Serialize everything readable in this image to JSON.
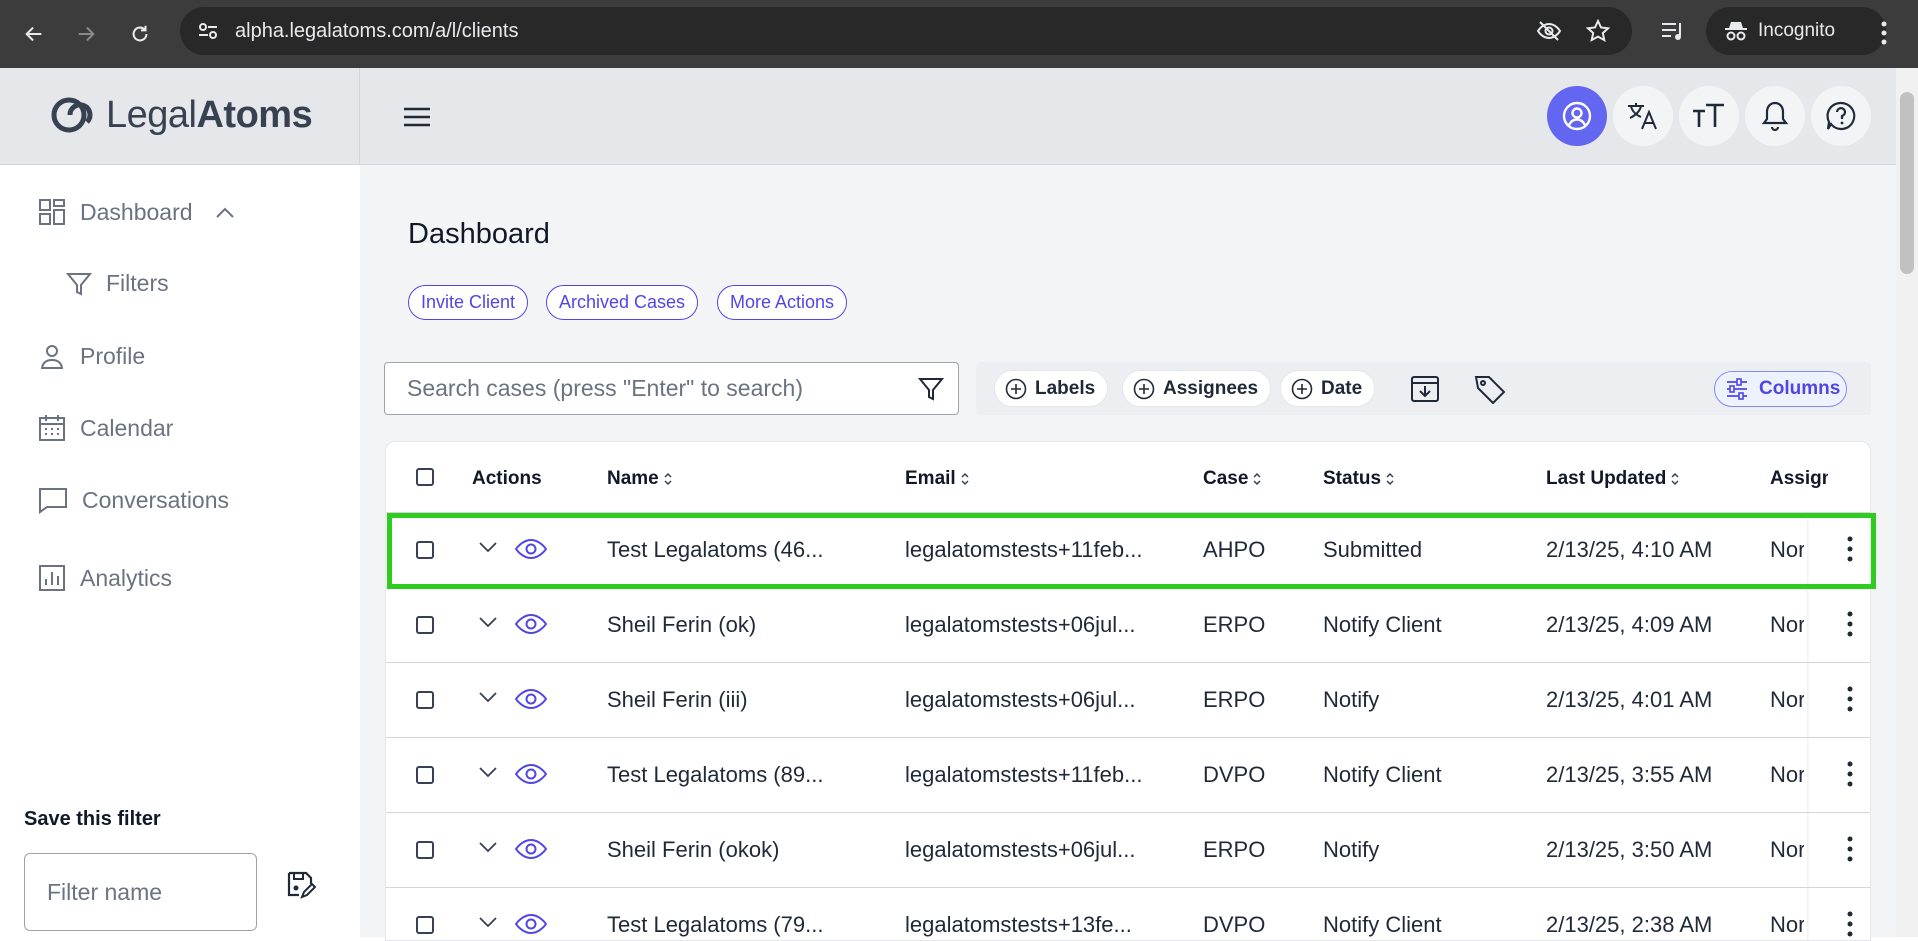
{
  "browser": {
    "url": "alpha.legalatoms.com/a/l/clients",
    "profile_label": "Incognito"
  },
  "brand": {
    "name_light": "Legal",
    "name_bold": "Atoms",
    "accent": "#6366f1"
  },
  "sidebar": {
    "items": [
      {
        "label": "Dashboard",
        "icon": "grid-icon"
      },
      {
        "label": "Filters",
        "icon": "filter-icon"
      },
      {
        "label": "Profile",
        "icon": "user-icon"
      },
      {
        "label": "Calendar",
        "icon": "calendar-icon"
      },
      {
        "label": "Conversations",
        "icon": "chat-icon"
      },
      {
        "label": "Analytics",
        "icon": "bar-chart-icon"
      }
    ],
    "save_filter_title": "Save this filter",
    "filter_name_placeholder": "Filter name"
  },
  "main": {
    "title": "Dashboard",
    "pills": [
      "Invite Client",
      "Archived Cases",
      "More Actions"
    ],
    "search_placeholder": "Search cases (press \"Enter\" to search)",
    "chips": [
      "Labels",
      "Assignees",
      "Date"
    ],
    "columns_label": "Columns"
  },
  "table": {
    "headers": {
      "actions": "Actions",
      "name": "Name",
      "email": "Email",
      "case": "Case",
      "status": "Status",
      "last_updated": "Last Updated",
      "assignee": "Assign"
    },
    "rows": [
      {
        "name": "Test Legalatoms (46...",
        "email": "legalatomstests+11feb...",
        "case": "AHPO",
        "status": "Submitted",
        "updated": "2/13/25, 4:10 AM",
        "assignee": "Nor"
      },
      {
        "name": "Sheil Ferin (ok)",
        "email": "legalatomstests+06jul...",
        "case": "ERPO",
        "status": "Notify Client",
        "updated": "2/13/25, 4:09 AM",
        "assignee": "Nor"
      },
      {
        "name": "Sheil Ferin (iii)",
        "email": "legalatomstests+06jul...",
        "case": "ERPO",
        "status": "Notify",
        "updated": "2/13/25, 4:01 AM",
        "assignee": "Nor"
      },
      {
        "name": "Test Legalatoms (89...",
        "email": "legalatomstests+11feb...",
        "case": "DVPO",
        "status": "Notify Client",
        "updated": "2/13/25, 3:55 AM",
        "assignee": "Nor"
      },
      {
        "name": "Sheil Ferin (okok)",
        "email": "legalatomstests+06jul...",
        "case": "ERPO",
        "status": "Notify",
        "updated": "2/13/25, 3:50 AM",
        "assignee": "Nor"
      },
      {
        "name": "Test Legalatoms (79...",
        "email": "legalatomstests+13fe...",
        "case": "DVPO",
        "status": "Notify Client",
        "updated": "2/13/25, 2:38 AM",
        "assignee": "Nor"
      }
    ],
    "highlight_color": "#2ecc1e"
  }
}
